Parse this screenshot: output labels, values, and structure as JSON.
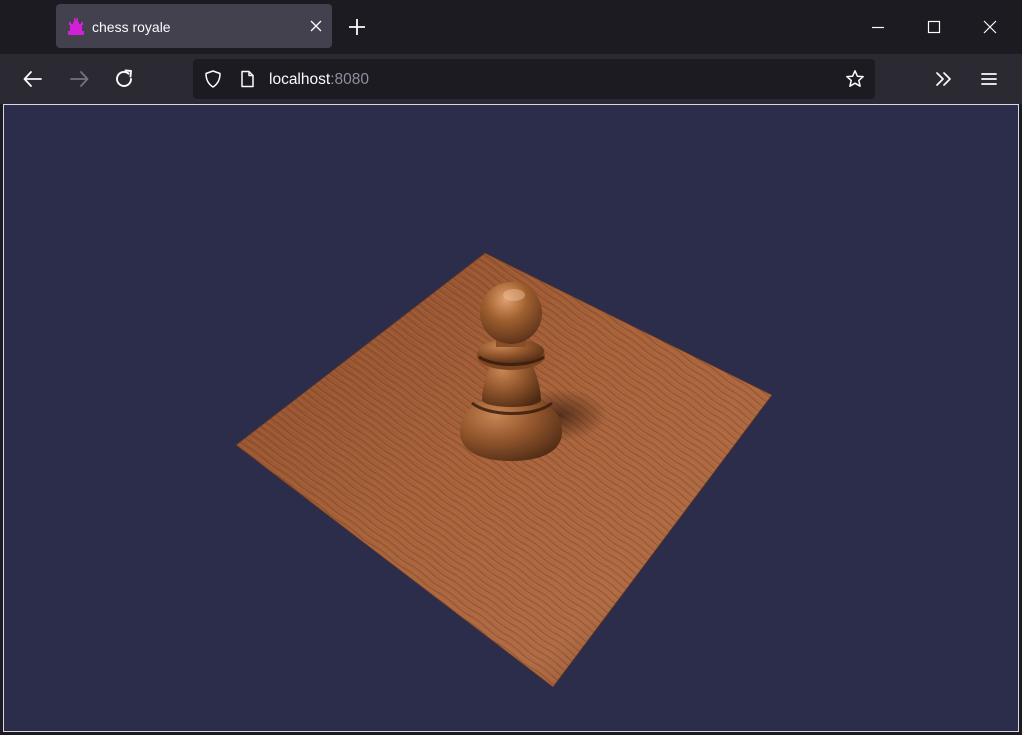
{
  "tab": {
    "title": "chess royale",
    "favicon": "chess-castle-icon",
    "favicon_color": "#d21fd8"
  },
  "navigation": {
    "back_icon": "arrow-left-icon",
    "forward_icon": "arrow-right-icon",
    "reload_icon": "reload-icon"
  },
  "urlbar": {
    "host": "localhost",
    "port": ":8080",
    "shield_icon": "shield-icon",
    "page_icon": "page-icon",
    "bookmark_icon": "star-icon"
  },
  "toolbar": {
    "overflow_icon": "chevrons-right-icon",
    "menu_icon": "hamburger-menu-icon"
  },
  "window_controls": [
    "minimize-icon",
    "maximize-icon",
    "close-icon"
  ],
  "scene": {
    "background_color": "#2c2d4a",
    "board_color": "#9a5a35",
    "piece": "pawn",
    "piece_color": "#8a4f2a"
  }
}
